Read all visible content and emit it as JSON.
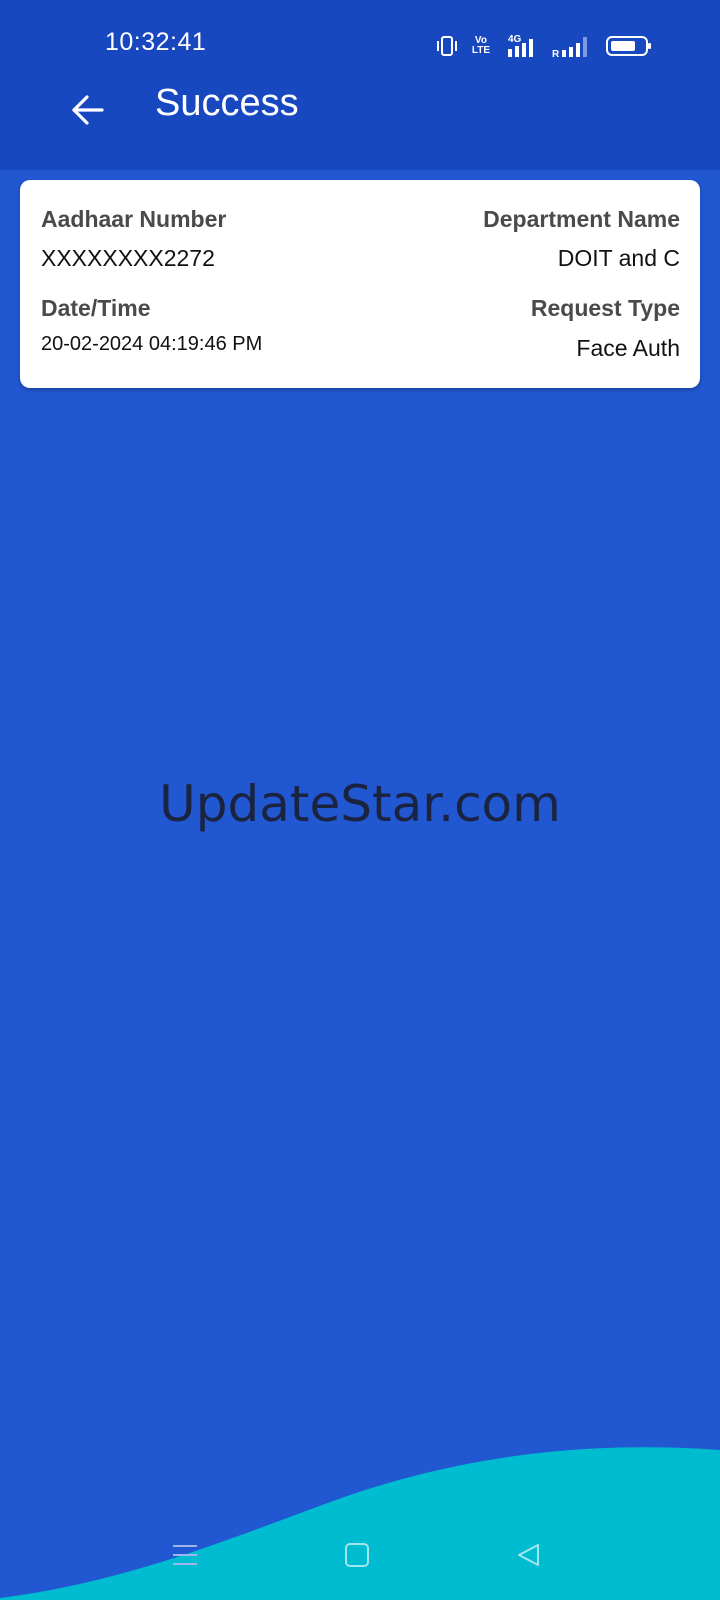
{
  "status_bar": {
    "time": "10:32:41",
    "vo_label_top": "Vo",
    "vo_label_bottom": "LTE",
    "network_label": "4G",
    "roaming_label": "R"
  },
  "header": {
    "title": "Success"
  },
  "card": {
    "aadhaar_label": "Aadhaar Number",
    "aadhaar_value": "XXXXXXXX2272",
    "department_label": "Department Name",
    "department_value": "DOIT and C",
    "datetime_label": "Date/Time",
    "datetime_value": "20-02-2024 04:19:46 PM",
    "request_type_label": "Request Type",
    "request_type_value": "Face Auth"
  },
  "watermark": "UpdateStar.com",
  "colors": {
    "background": "#2257d2",
    "header": "#1848bf",
    "wave": "#00bcd0",
    "card": "#ffffff"
  },
  "icons": {
    "back": "arrow-left-icon",
    "vibrate": "vibrate-icon",
    "signal": "signal-bars-icon",
    "battery": "battery-icon",
    "nav_menu": "menu-icon",
    "nav_home": "square-home-icon",
    "nav_back": "triangle-back-icon"
  }
}
